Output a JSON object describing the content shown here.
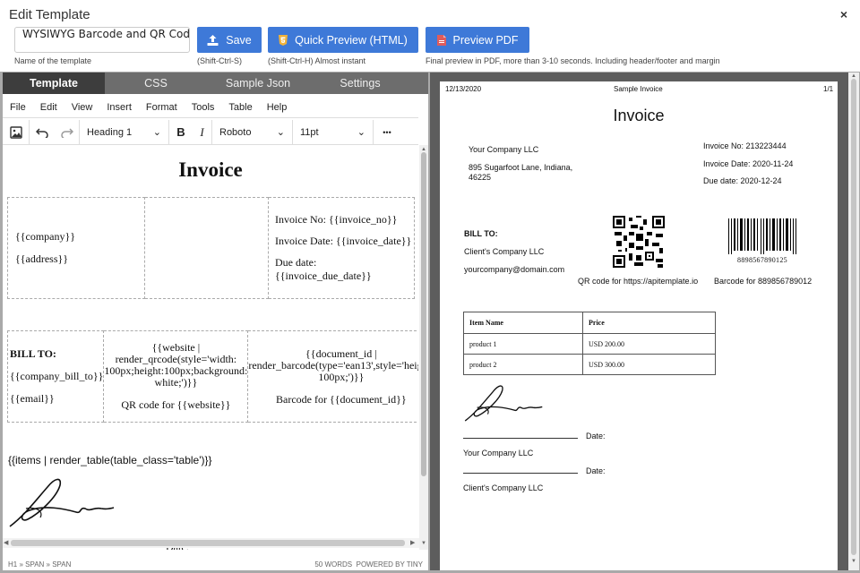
{
  "dialog": {
    "title": "Edit Template",
    "close_icon": "×"
  },
  "template_name": {
    "value": "WYSIWYG Barcode and QR Code Sa",
    "hint": "Name of the template"
  },
  "buttons": {
    "save": {
      "label": "Save",
      "hint": "(Shift-Ctrl-S)"
    },
    "quick_preview": {
      "label": "Quick Preview (HTML)",
      "hint": "(Shift-Ctrl-H) Almost instant"
    },
    "preview_pdf": {
      "label": "Preview PDF",
      "hint": "Final preview in PDF, more than 3-10 seconds. Including header/footer and margin"
    }
  },
  "tabs": [
    "Template",
    "CSS",
    "Sample Json",
    "Settings"
  ],
  "menu": [
    "File",
    "Edit",
    "View",
    "Insert",
    "Format",
    "Tools",
    "Table",
    "Help"
  ],
  "toolbar": {
    "block": "Heading 1",
    "font": "Roboto",
    "size": "11pt",
    "more": "•••"
  },
  "editor": {
    "heading": "Invoice",
    "company": "{{company}}",
    "address": "{{address}}",
    "invoice_no": "Invoice No: {{invoice_no}}",
    "invoice_date": "Invoice Date: {{invoice_date}}",
    "due_date_label": "Due date:",
    "due_date_value": "{{invoice_due_date}}",
    "bill_to": "BILL TO:",
    "company_bill_to": "{{company_bill_to}}",
    "email": "{{email}}",
    "qr_code_lines": [
      "{{website |",
      "render_qrcode(style='width:",
      "100px;height:100px;background:",
      "white;')}}"
    ],
    "qr_caption": "QR code for {{website}}",
    "barcode_lines": [
      "{{document_id |",
      "render_barcode(type='ean13',style='height:",
      "100px;')}}"
    ],
    "barcode_caption": "Barcode for {{document_id}}",
    "items": "{{items | render_table(table_class='table')}}",
    "date_label": "Date:"
  },
  "status_bar": {
    "path": "H1 » SPAN » SPAN",
    "words": "50 WORDS",
    "powered": "POWERED BY TINY"
  },
  "preview": {
    "header_date": "12/13/2020",
    "header_title": "Sample Invoice",
    "header_page": "1/1",
    "title": "Invoice",
    "company": "Your Company LLC",
    "address": "895 Sugarfoot Lane, Indiana, 46225",
    "invoice_no": "Invoice No: 213223444",
    "invoice_date": "Invoice Date: 2020-11-24",
    "due_date": "Due date: 2020-12-24",
    "bill_to": "BILL TO:",
    "client": "Client's Company LLC",
    "email": "yourcompany@domain.com",
    "qr_caption": "QR code for https://apitemplate.io",
    "barcode_number": "8898567890125",
    "barcode_caption": "Barcode for 889856789012",
    "items_header": [
      "Item Name",
      "Price"
    ],
    "items": [
      [
        "product 1",
        "USD 200.00"
      ],
      [
        "product 2",
        "USD 300.00"
      ]
    ],
    "date_label": "Date:",
    "sign1": "Your Company LLC",
    "sign2": "Client's Company LLC"
  },
  "colors": {
    "accent": "#3e79d8",
    "tab_bar": "#6d6d6d",
    "tab_active": "#3d3d3d",
    "preview_bg": "#5d5d5d"
  }
}
